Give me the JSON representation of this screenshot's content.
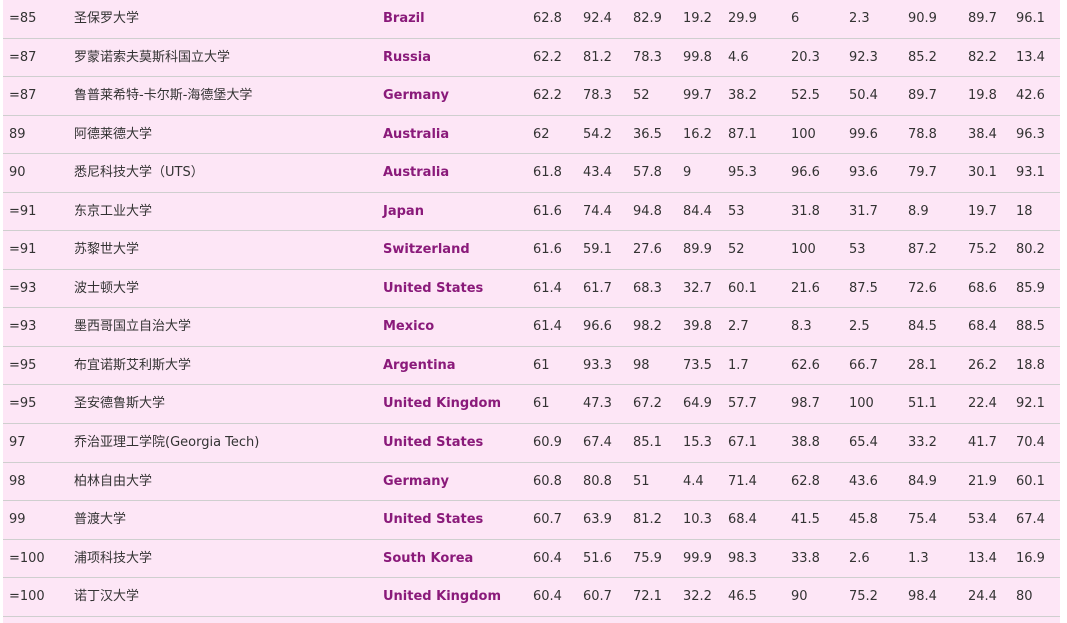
{
  "colors": {
    "row_background": "#fde6f6",
    "country_text": "#8a1a7a",
    "border": "#cfcfcf",
    "text": "#333333"
  },
  "rows": [
    {
      "rank": "=85",
      "university": "圣保罗大学",
      "country": "Brazil",
      "scores": [
        "62.8",
        "92.4",
        "82.9",
        "19.2",
        "29.9",
        "6",
        "2.3",
        "90.9",
        "89.7",
        "96.1"
      ]
    },
    {
      "rank": "=87",
      "university": "罗蒙诺索夫莫斯科国立大学",
      "country": "Russia",
      "scores": [
        "62.2",
        "81.2",
        "78.3",
        "99.8",
        "4.6",
        "20.3",
        "92.3",
        "85.2",
        "82.2",
        "13.4"
      ]
    },
    {
      "rank": "=87",
      "university": "鲁普莱希特-卡尔斯-海德堡大学",
      "country": "Germany",
      "scores": [
        "62.2",
        "78.3",
        "52",
        "99.7",
        "38.2",
        "52.5",
        "50.4",
        "89.7",
        "19.8",
        "42.6"
      ]
    },
    {
      "rank": "89",
      "university": "阿德莱德大学",
      "country": "Australia",
      "scores": [
        "62",
        "54.2",
        "36.5",
        "16.2",
        "87.1",
        "100",
        "99.6",
        "78.8",
        "38.4",
        "96.3"
      ]
    },
    {
      "rank": "90",
      "university": "悉尼科技大学（UTS）",
      "country": "Australia",
      "scores": [
        "61.8",
        "43.4",
        "57.8",
        "9",
        "95.3",
        "96.6",
        "93.6",
        "79.7",
        "30.1",
        "93.1"
      ]
    },
    {
      "rank": "=91",
      "university": "东京工业大学",
      "country": "Japan",
      "scores": [
        "61.6",
        "74.4",
        "94.8",
        "84.4",
        "53",
        "31.8",
        "31.7",
        "8.9",
        "19.7",
        "18"
      ]
    },
    {
      "rank": "=91",
      "university": "苏黎世大学",
      "country": "Switzerland",
      "scores": [
        "61.6",
        "59.1",
        "27.6",
        "89.9",
        "52",
        "100",
        "53",
        "87.2",
        "75.2",
        "80.2"
      ]
    },
    {
      "rank": "=93",
      "university": "波士顿大学",
      "country": "United States",
      "scores": [
        "61.4",
        "61.7",
        "68.3",
        "32.7",
        "60.1",
        "21.6",
        "87.5",
        "72.6",
        "68.6",
        "85.9"
      ]
    },
    {
      "rank": "=93",
      "university": "墨西哥国立自治大学",
      "country": "Mexico",
      "scores": [
        "61.4",
        "96.6",
        "98.2",
        "39.8",
        "2.7",
        "8.3",
        "2.5",
        "84.5",
        "68.4",
        "88.5"
      ]
    },
    {
      "rank": "=95",
      "university": "布宜诺斯艾利斯大学",
      "country": "Argentina",
      "scores": [
        "61",
        "93.3",
        "98",
        "73.5",
        "1.7",
        "62.6",
        "66.7",
        "28.1",
        "26.2",
        "18.8"
      ]
    },
    {
      "rank": "=95",
      "university": "圣安德鲁斯大学",
      "country": "United Kingdom",
      "scores": [
        "61",
        "47.3",
        "67.2",
        "64.9",
        "57.7",
        "98.7",
        "100",
        "51.1",
        "22.4",
        "92.1"
      ]
    },
    {
      "rank": "97",
      "university": "乔治亚理工学院(Georgia Tech)",
      "country": "United States",
      "scores": [
        "60.9",
        "67.4",
        "85.1",
        "15.3",
        "67.1",
        "38.8",
        "65.4",
        "33.2",
        "41.7",
        "70.4"
      ]
    },
    {
      "rank": "98",
      "university": "柏林自由大学",
      "country": "Germany",
      "scores": [
        "60.8",
        "80.8",
        "51",
        "4.4",
        "71.4",
        "62.8",
        "43.6",
        "84.9",
        "21.9",
        "60.1"
      ]
    },
    {
      "rank": "99",
      "university": "普渡大学",
      "country": "United States",
      "scores": [
        "60.7",
        "63.9",
        "81.2",
        "10.3",
        "68.4",
        "41.5",
        "45.8",
        "75.4",
        "53.4",
        "67.4"
      ]
    },
    {
      "rank": "=100",
      "university": "浦项科技大学",
      "country": "South Korea",
      "scores": [
        "60.4",
        "51.6",
        "75.9",
        "99.9",
        "98.3",
        "33.8",
        "2.6",
        "1.3",
        "13.4",
        "16.9"
      ]
    },
    {
      "rank": "=100",
      "university": "诺丁汉大学",
      "country": "United Kingdom",
      "scores": [
        "60.4",
        "60.7",
        "72.1",
        "32.2",
        "46.5",
        "90",
        "75.2",
        "98.4",
        "24.4",
        "80"
      ]
    }
  ]
}
